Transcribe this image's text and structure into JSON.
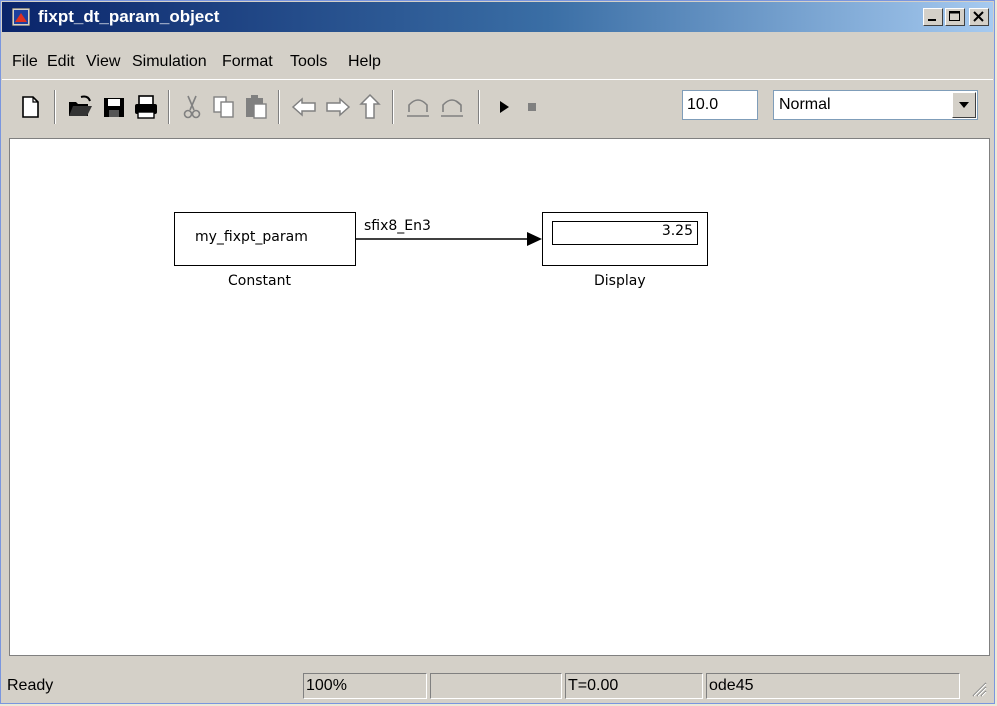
{
  "window": {
    "title": "fixpt_dt_param_object"
  },
  "menu": [
    "File",
    "Edit",
    "View",
    "Simulation",
    "Format",
    "Tools",
    "Help"
  ],
  "toolbar": {
    "stop_time": "10.0",
    "sim_mode": "Normal",
    "icons": [
      "new-model-icon",
      "open-icon",
      "save-icon",
      "print-icon",
      "cut-icon",
      "copy-icon",
      "paste-icon",
      "back-icon",
      "forward-icon",
      "up-icon",
      "undo-icon",
      "redo-icon",
      "start-simulation-icon",
      "stop-simulation-icon"
    ]
  },
  "model": {
    "constant_block": {
      "value": "my_fixpt_param",
      "label": "Constant"
    },
    "signal": {
      "label": "sfix8_En3"
    },
    "display_block": {
      "value": "3.25",
      "label": "Display"
    }
  },
  "status": {
    "state": "Ready",
    "zoom": "100%",
    "empty": "",
    "time": "T=0.00",
    "solver": "ode45"
  }
}
